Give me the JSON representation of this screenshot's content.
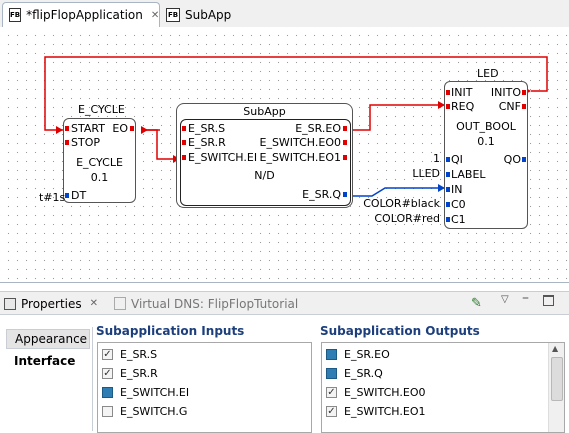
{
  "editor_tabs": [
    {
      "label": "*flipFlopApplication",
      "icon": "fb-icon",
      "active": true
    },
    {
      "label": "SubApp",
      "icon": "fb-icon",
      "active": false
    }
  ],
  "blocks": {
    "e_cycle": {
      "instance": "E_CYCLE",
      "inputs": [
        "START",
        "STOP",
        "DT"
      ],
      "outputs": [
        "EO"
      ],
      "type": "E_CYCLE",
      "version": "0.1",
      "param": "t#1s"
    },
    "subapp": {
      "title": "SubApp",
      "inputs": [
        "E_SR.S",
        "E_SR.R",
        "E_SWITCH.EI"
      ],
      "outputs": [
        "E_SR.EO",
        "E_SWITCH.EO0",
        "E_SWITCH.EO1",
        "E_SR.Q"
      ],
      "type": "N/D"
    },
    "led": {
      "instance": "LED",
      "inputs": [
        "INIT",
        "REQ",
        "QI",
        "LABEL",
        "IN",
        "C0",
        "C1"
      ],
      "outputs": [
        "INITO",
        "CNF",
        "QO"
      ],
      "type": "OUT_BOOL",
      "version": "0.1",
      "params": {
        "qi": "1",
        "label": "LLED",
        "c0": "COLOR#black",
        "c1": "COLOR#red"
      }
    }
  },
  "view_tabs": [
    {
      "label": "Properties",
      "icon": "properties-icon",
      "active": true
    },
    {
      "label": "Virtual DNS: FlipFlopTutorial",
      "icon": "dns-icon",
      "active": false
    }
  ],
  "properties": {
    "side_tabs": [
      "Appearance",
      "Interface"
    ],
    "inputs_title": "Subapplication Inputs",
    "outputs_title": "Subapplication Outputs",
    "inputs": [
      {
        "name": "E_SR.S",
        "state": "checked"
      },
      {
        "name": "E_SR.R",
        "state": "checked"
      },
      {
        "name": "E_SWITCH.EI",
        "state": "event"
      },
      {
        "name": "E_SWITCH.G",
        "state": "unchecked"
      }
    ],
    "outputs": [
      {
        "name": "E_SR.EO",
        "state": "event"
      },
      {
        "name": "E_SR.Q",
        "state": "event"
      },
      {
        "name": "E_SWITCH.EO0",
        "state": "checked"
      },
      {
        "name": "E_SWITCH.EO1",
        "state": "checked"
      }
    ]
  },
  "colors": {
    "event": "#e00000",
    "data": "#0044cc",
    "title": "#1c3f7c"
  }
}
